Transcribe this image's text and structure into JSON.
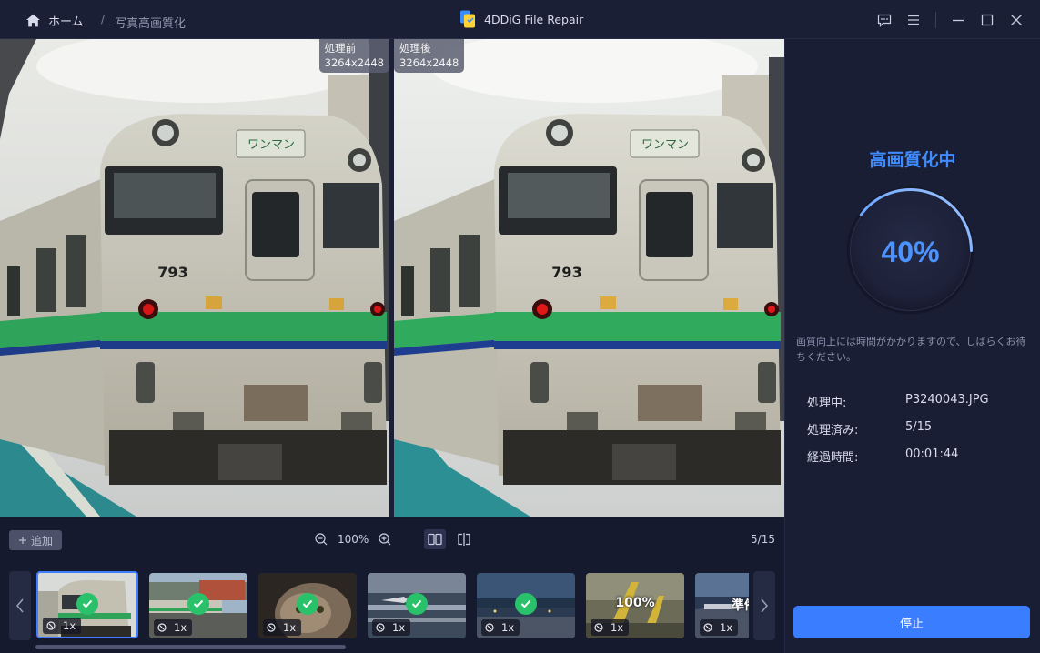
{
  "titlebar": {
    "home_label": "ホーム",
    "breadcrumb_separator": "/",
    "breadcrumb_current": "写真高画質化",
    "app_title": "4DDiG File Repair"
  },
  "preview": {
    "before_label": "処理前",
    "before_resolution": "3264x2448",
    "after_label": "処理後",
    "after_resolution": "3264x2448",
    "train_number": "793",
    "sign_text": "ワンマン"
  },
  "toolbar": {
    "add_label": "追加",
    "zoom_level": "100%",
    "page_counter": "5/15"
  },
  "thumbnails": [
    {
      "status": "done",
      "status_text": "",
      "scale": "1x",
      "selected": true
    },
    {
      "status": "done",
      "status_text": "",
      "scale": "1x",
      "selected": false
    },
    {
      "status": "done",
      "status_text": "",
      "scale": "1x",
      "selected": false
    },
    {
      "status": "done",
      "status_text": "",
      "scale": "1x",
      "selected": false
    },
    {
      "status": "done",
      "status_text": "",
      "scale": "1x",
      "selected": false
    },
    {
      "status": "processing",
      "status_text": "100%",
      "scale": "1x",
      "selected": false
    },
    {
      "status": "pending",
      "status_text": "準備",
      "scale": "1x",
      "selected": false
    }
  ],
  "panel": {
    "title": "高画質化中",
    "progress_text": "40%",
    "progress_fraction": 0.4,
    "note": "画質向上には時間がかかりますので、しばらくお待ちください。",
    "processing_label": "処理中:",
    "processing_value": "P3240043.JPG",
    "processed_label": "処理済み:",
    "processed_value": "5/15",
    "elapsed_label": "経過時間:",
    "elapsed_value": "00:01:44",
    "stop_label": "停止"
  },
  "colors": {
    "accent": "#3b7dff",
    "success": "#29c16a",
    "background": "#161a2e",
    "panel": "#1a1e34"
  }
}
